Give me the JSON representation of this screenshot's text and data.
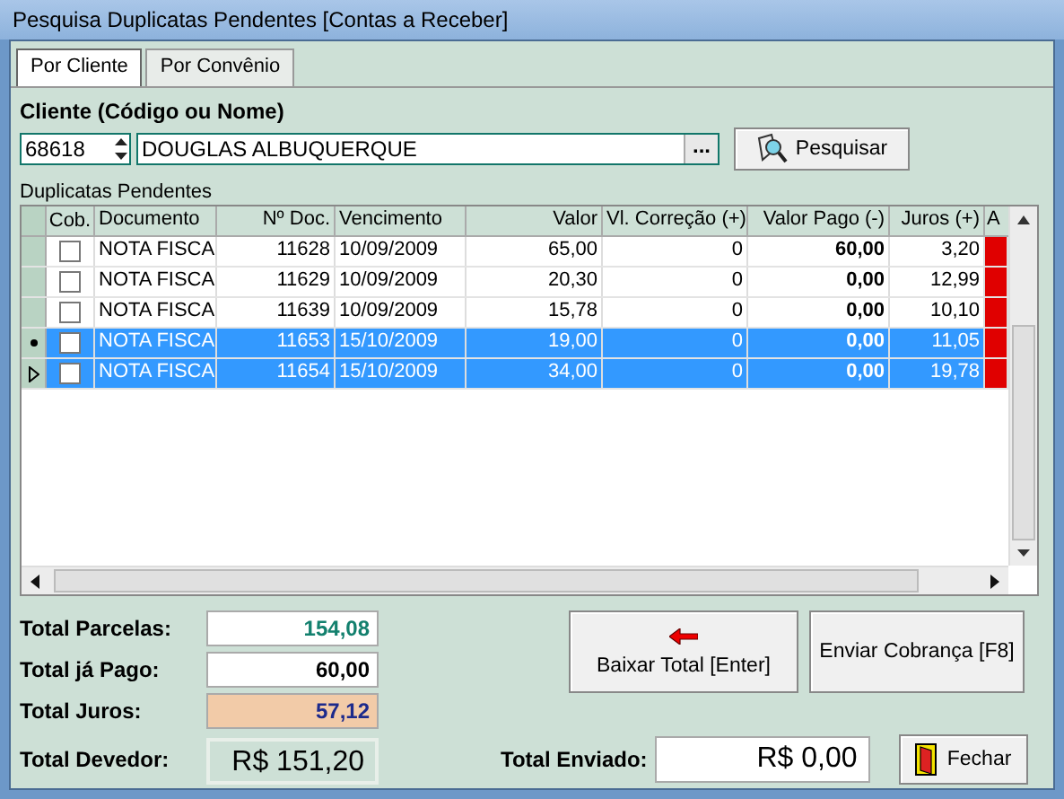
{
  "window": {
    "title": "Pesquisa Duplicatas Pendentes [Contas a Receber]"
  },
  "tabs": [
    {
      "label": "Por Cliente",
      "selected": true
    },
    {
      "label": "Por Convênio",
      "selected": false
    }
  ],
  "client": {
    "label": "Cliente (Código ou Nome)",
    "code": "68618",
    "name": "DOUGLAS ALBUQUERQUE",
    "browse_button": "...",
    "search_button": "Pesquisar"
  },
  "grid": {
    "label": "Duplicatas Pendentes",
    "columns": [
      "Cob.",
      "Documento",
      "Nº Doc.",
      "Vencimento",
      "Valor",
      "Vl. Correção (+)",
      "Valor Pago (-)",
      "Juros (+)",
      "A"
    ],
    "rows": [
      {
        "current": false,
        "pointer": false,
        "selected": false,
        "checked": false,
        "cells": [
          "",
          "NOTA FISCA",
          "11628",
          "10/09/2009",
          "65,00",
          "0",
          "60,00",
          "3,20",
          ""
        ]
      },
      {
        "current": false,
        "pointer": false,
        "selected": false,
        "checked": false,
        "cells": [
          "",
          "NOTA FISCA",
          "11629",
          "10/09/2009",
          "20,30",
          "0",
          "0,00",
          "12,99",
          ""
        ]
      },
      {
        "current": false,
        "pointer": false,
        "selected": false,
        "checked": false,
        "cells": [
          "",
          "NOTA FISCA",
          "11639",
          "10/09/2009",
          "15,78",
          "0",
          "0,00",
          "10,10",
          ""
        ]
      },
      {
        "current": true,
        "pointer": false,
        "selected": true,
        "checked": false,
        "cells": [
          "",
          "NOTA FISCA",
          "11653",
          "15/10/2009",
          "19,00",
          "0",
          "0,00",
          "11,05",
          ""
        ]
      },
      {
        "current": false,
        "pointer": true,
        "selected": true,
        "checked": false,
        "cells": [
          "",
          "NOTA FISCA",
          "11654",
          "15/10/2009",
          "34,00",
          "0",
          "0,00",
          "19,78",
          ""
        ]
      }
    ]
  },
  "totals": [
    {
      "kind": "parcelas",
      "label": "Total Parcelas:",
      "value": "154,08"
    },
    {
      "kind": "pago",
      "label": "Total já Pago:",
      "value": "60,00"
    },
    {
      "kind": "juros",
      "label": "Total Juros:",
      "value": "57,12"
    },
    {
      "kind": "devedor",
      "label": "Total Devedor:",
      "value": "R$ 151,20"
    }
  ],
  "buttons": {
    "baixar": "Baixar Total [Enter]",
    "enviar": "Enviar Cobrança [F8]",
    "fechar": "Fechar"
  },
  "sent": {
    "label": "Total Enviado:",
    "value": "R$ 0,00"
  }
}
